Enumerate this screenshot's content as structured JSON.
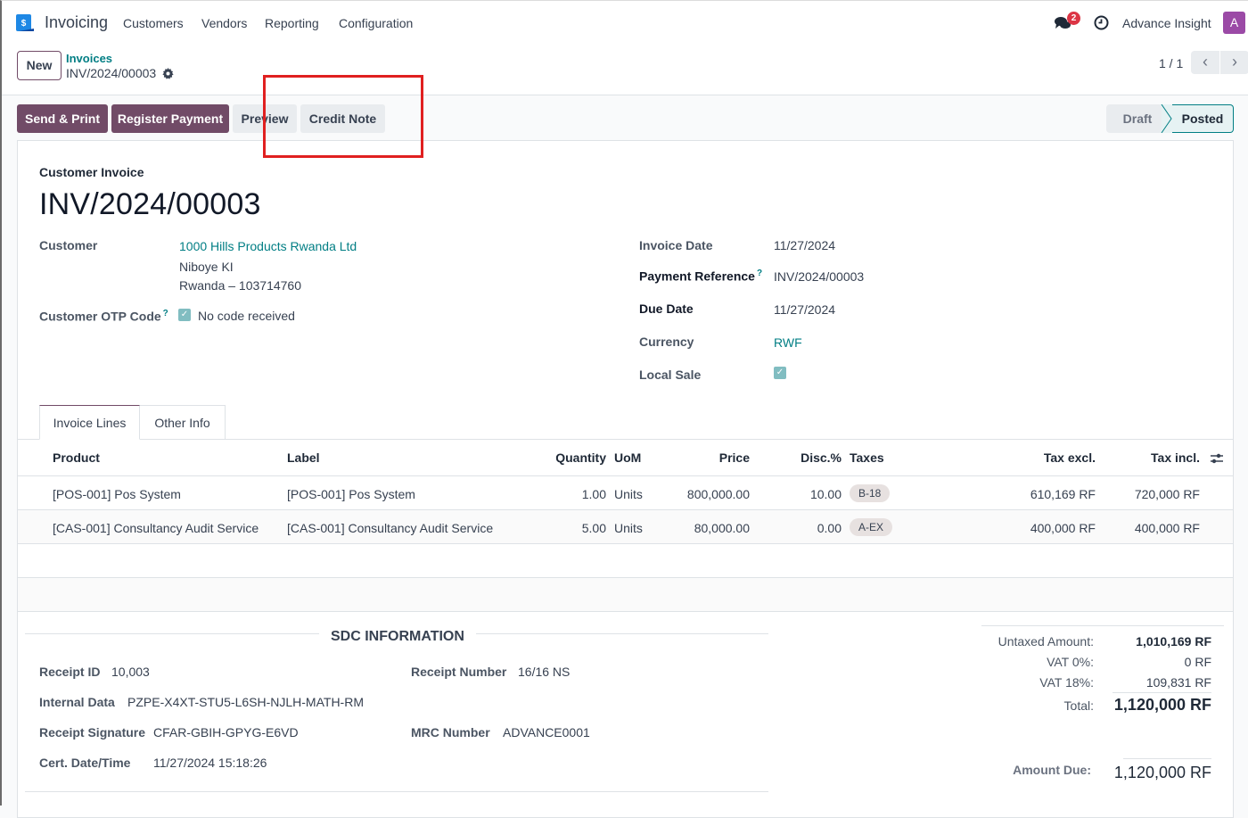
{
  "navbar": {
    "app_name": "Invoicing",
    "menu": [
      "Customers",
      "Vendors",
      "Reporting",
      "Configuration"
    ],
    "chat_badge": "2",
    "user_name": "Advance Insight",
    "avatar_letter": "A",
    "avatar_color": "#9b4aa6"
  },
  "control_panel": {
    "new_label": "New",
    "breadcrumb_parent": "Invoices",
    "breadcrumb_current": "INV/2024/00003",
    "pager": "1 / 1"
  },
  "actions": {
    "send_print": "Send & Print",
    "register_payment": "Register Payment",
    "preview": "Preview",
    "credit_note": "Credit Note"
  },
  "status": {
    "steps": [
      "Draft",
      "Posted"
    ],
    "current": "Posted"
  },
  "form": {
    "doc_type": "Customer Invoice",
    "title": "INV/2024/00003",
    "customer_label": "Customer",
    "customer_name": "1000 Hills Products Rwanda Ltd",
    "customer_address_1": "Niboye KI",
    "customer_address_2": "Rwanda – 103714760",
    "otp_label": "Customer OTP Code",
    "otp_value": "No code received",
    "otp_checked": true,
    "invoice_date_label": "Invoice Date",
    "invoice_date": "11/27/2024",
    "payment_ref_label": "Payment Reference",
    "payment_ref": "INV/2024/00003",
    "due_date_label": "Due Date",
    "due_date": "11/27/2024",
    "currency_label": "Currency",
    "currency": "RWF",
    "local_sale_label": "Local Sale",
    "local_sale_checked": true
  },
  "tabs": [
    "Invoice Lines",
    "Other Info"
  ],
  "lines": {
    "headers": [
      "Product",
      "Label",
      "Quantity",
      "UoM",
      "Price",
      "Disc.%",
      "Taxes",
      "Tax excl.",
      "Tax incl."
    ],
    "rows": [
      {
        "product": "[POS-001] Pos System",
        "label": "[POS-001] Pos System",
        "quantity": "1.00",
        "uom": "Units",
        "price": "800,000.00",
        "disc": "10.00",
        "tax": "B-18",
        "tax_excl": "610,169 RF",
        "tax_incl": "720,000 RF"
      },
      {
        "product": "[CAS-001] Consultancy Audit Service",
        "label": "[CAS-001] Consultancy Audit Service",
        "quantity": "5.00",
        "uom": "Units",
        "price": "80,000.00",
        "disc": "0.00",
        "tax": "A-EX",
        "tax_excl": "400,000 RF",
        "tax_incl": "400,000 RF"
      }
    ]
  },
  "sdc": {
    "title": "SDC INFORMATION",
    "receipt_id_label": "Receipt ID",
    "receipt_id": "10,003",
    "internal_data_label": "Internal Data",
    "internal_data": "PZPE-X4XT-STU5-L6SH-NJLH-MATH-RM",
    "receipt_signature_label": "Receipt Signature",
    "receipt_signature": "CFAR-GBIH-GPYG-E6VD",
    "cert_datetime_label": "Cert. Date/Time",
    "cert_datetime": "11/27/2024 15:18:26",
    "receipt_number_label": "Receipt Number",
    "receipt_number": "16/16 NS",
    "mrc_number_label": "MRC Number",
    "mrc_number": "ADVANCE0001"
  },
  "totals": {
    "untaxed_label": "Untaxed Amount:",
    "untaxed": "1,010,169 RF",
    "vat0_label": "VAT 0%:",
    "vat0": "0 RF",
    "vat18_label": "VAT 18%:",
    "vat18": "109,831 RF",
    "total_label": "Total:",
    "total": "1,120,000 RF",
    "amount_due_label": "Amount Due:",
    "amount_due": "1,120,000 RF"
  },
  "colors": {
    "brand": "#714b67",
    "link": "#017e84",
    "highlight": "#e02020"
  }
}
